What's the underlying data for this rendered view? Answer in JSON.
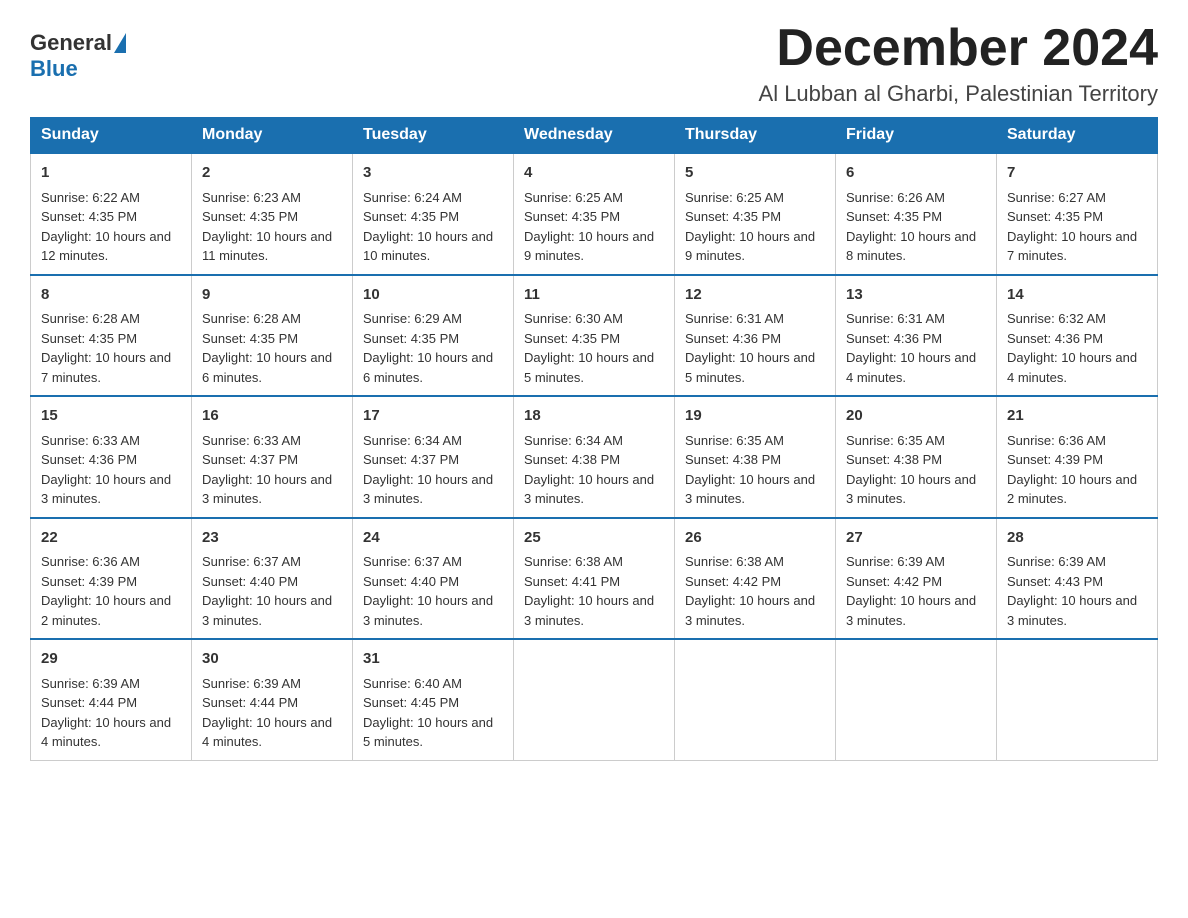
{
  "header": {
    "logo_general": "General",
    "logo_blue": "Blue",
    "month_title": "December 2024",
    "subtitle": "Al Lubban al Gharbi, Palestinian Territory"
  },
  "days_of_week": [
    "Sunday",
    "Monday",
    "Tuesday",
    "Wednesday",
    "Thursday",
    "Friday",
    "Saturday"
  ],
  "weeks": [
    [
      {
        "day": "1",
        "sunrise": "Sunrise: 6:22 AM",
        "sunset": "Sunset: 4:35 PM",
        "daylight": "Daylight: 10 hours and 12 minutes."
      },
      {
        "day": "2",
        "sunrise": "Sunrise: 6:23 AM",
        "sunset": "Sunset: 4:35 PM",
        "daylight": "Daylight: 10 hours and 11 minutes."
      },
      {
        "day": "3",
        "sunrise": "Sunrise: 6:24 AM",
        "sunset": "Sunset: 4:35 PM",
        "daylight": "Daylight: 10 hours and 10 minutes."
      },
      {
        "day": "4",
        "sunrise": "Sunrise: 6:25 AM",
        "sunset": "Sunset: 4:35 PM",
        "daylight": "Daylight: 10 hours and 9 minutes."
      },
      {
        "day": "5",
        "sunrise": "Sunrise: 6:25 AM",
        "sunset": "Sunset: 4:35 PM",
        "daylight": "Daylight: 10 hours and 9 minutes."
      },
      {
        "day": "6",
        "sunrise": "Sunrise: 6:26 AM",
        "sunset": "Sunset: 4:35 PM",
        "daylight": "Daylight: 10 hours and 8 minutes."
      },
      {
        "day": "7",
        "sunrise": "Sunrise: 6:27 AM",
        "sunset": "Sunset: 4:35 PM",
        "daylight": "Daylight: 10 hours and 7 minutes."
      }
    ],
    [
      {
        "day": "8",
        "sunrise": "Sunrise: 6:28 AM",
        "sunset": "Sunset: 4:35 PM",
        "daylight": "Daylight: 10 hours and 7 minutes."
      },
      {
        "day": "9",
        "sunrise": "Sunrise: 6:28 AM",
        "sunset": "Sunset: 4:35 PM",
        "daylight": "Daylight: 10 hours and 6 minutes."
      },
      {
        "day": "10",
        "sunrise": "Sunrise: 6:29 AM",
        "sunset": "Sunset: 4:35 PM",
        "daylight": "Daylight: 10 hours and 6 minutes."
      },
      {
        "day": "11",
        "sunrise": "Sunrise: 6:30 AM",
        "sunset": "Sunset: 4:35 PM",
        "daylight": "Daylight: 10 hours and 5 minutes."
      },
      {
        "day": "12",
        "sunrise": "Sunrise: 6:31 AM",
        "sunset": "Sunset: 4:36 PM",
        "daylight": "Daylight: 10 hours and 5 minutes."
      },
      {
        "day": "13",
        "sunrise": "Sunrise: 6:31 AM",
        "sunset": "Sunset: 4:36 PM",
        "daylight": "Daylight: 10 hours and 4 minutes."
      },
      {
        "day": "14",
        "sunrise": "Sunrise: 6:32 AM",
        "sunset": "Sunset: 4:36 PM",
        "daylight": "Daylight: 10 hours and 4 minutes."
      }
    ],
    [
      {
        "day": "15",
        "sunrise": "Sunrise: 6:33 AM",
        "sunset": "Sunset: 4:36 PM",
        "daylight": "Daylight: 10 hours and 3 minutes."
      },
      {
        "day": "16",
        "sunrise": "Sunrise: 6:33 AM",
        "sunset": "Sunset: 4:37 PM",
        "daylight": "Daylight: 10 hours and 3 minutes."
      },
      {
        "day": "17",
        "sunrise": "Sunrise: 6:34 AM",
        "sunset": "Sunset: 4:37 PM",
        "daylight": "Daylight: 10 hours and 3 minutes."
      },
      {
        "day": "18",
        "sunrise": "Sunrise: 6:34 AM",
        "sunset": "Sunset: 4:38 PM",
        "daylight": "Daylight: 10 hours and 3 minutes."
      },
      {
        "day": "19",
        "sunrise": "Sunrise: 6:35 AM",
        "sunset": "Sunset: 4:38 PM",
        "daylight": "Daylight: 10 hours and 3 minutes."
      },
      {
        "day": "20",
        "sunrise": "Sunrise: 6:35 AM",
        "sunset": "Sunset: 4:38 PM",
        "daylight": "Daylight: 10 hours and 3 minutes."
      },
      {
        "day": "21",
        "sunrise": "Sunrise: 6:36 AM",
        "sunset": "Sunset: 4:39 PM",
        "daylight": "Daylight: 10 hours and 2 minutes."
      }
    ],
    [
      {
        "day": "22",
        "sunrise": "Sunrise: 6:36 AM",
        "sunset": "Sunset: 4:39 PM",
        "daylight": "Daylight: 10 hours and 2 minutes."
      },
      {
        "day": "23",
        "sunrise": "Sunrise: 6:37 AM",
        "sunset": "Sunset: 4:40 PM",
        "daylight": "Daylight: 10 hours and 3 minutes."
      },
      {
        "day": "24",
        "sunrise": "Sunrise: 6:37 AM",
        "sunset": "Sunset: 4:40 PM",
        "daylight": "Daylight: 10 hours and 3 minutes."
      },
      {
        "day": "25",
        "sunrise": "Sunrise: 6:38 AM",
        "sunset": "Sunset: 4:41 PM",
        "daylight": "Daylight: 10 hours and 3 minutes."
      },
      {
        "day": "26",
        "sunrise": "Sunrise: 6:38 AM",
        "sunset": "Sunset: 4:42 PM",
        "daylight": "Daylight: 10 hours and 3 minutes."
      },
      {
        "day": "27",
        "sunrise": "Sunrise: 6:39 AM",
        "sunset": "Sunset: 4:42 PM",
        "daylight": "Daylight: 10 hours and 3 minutes."
      },
      {
        "day": "28",
        "sunrise": "Sunrise: 6:39 AM",
        "sunset": "Sunset: 4:43 PM",
        "daylight": "Daylight: 10 hours and 3 minutes."
      }
    ],
    [
      {
        "day": "29",
        "sunrise": "Sunrise: 6:39 AM",
        "sunset": "Sunset: 4:44 PM",
        "daylight": "Daylight: 10 hours and 4 minutes."
      },
      {
        "day": "30",
        "sunrise": "Sunrise: 6:39 AM",
        "sunset": "Sunset: 4:44 PM",
        "daylight": "Daylight: 10 hours and 4 minutes."
      },
      {
        "day": "31",
        "sunrise": "Sunrise: 6:40 AM",
        "sunset": "Sunset: 4:45 PM",
        "daylight": "Daylight: 10 hours and 5 minutes."
      },
      null,
      null,
      null,
      null
    ]
  ]
}
